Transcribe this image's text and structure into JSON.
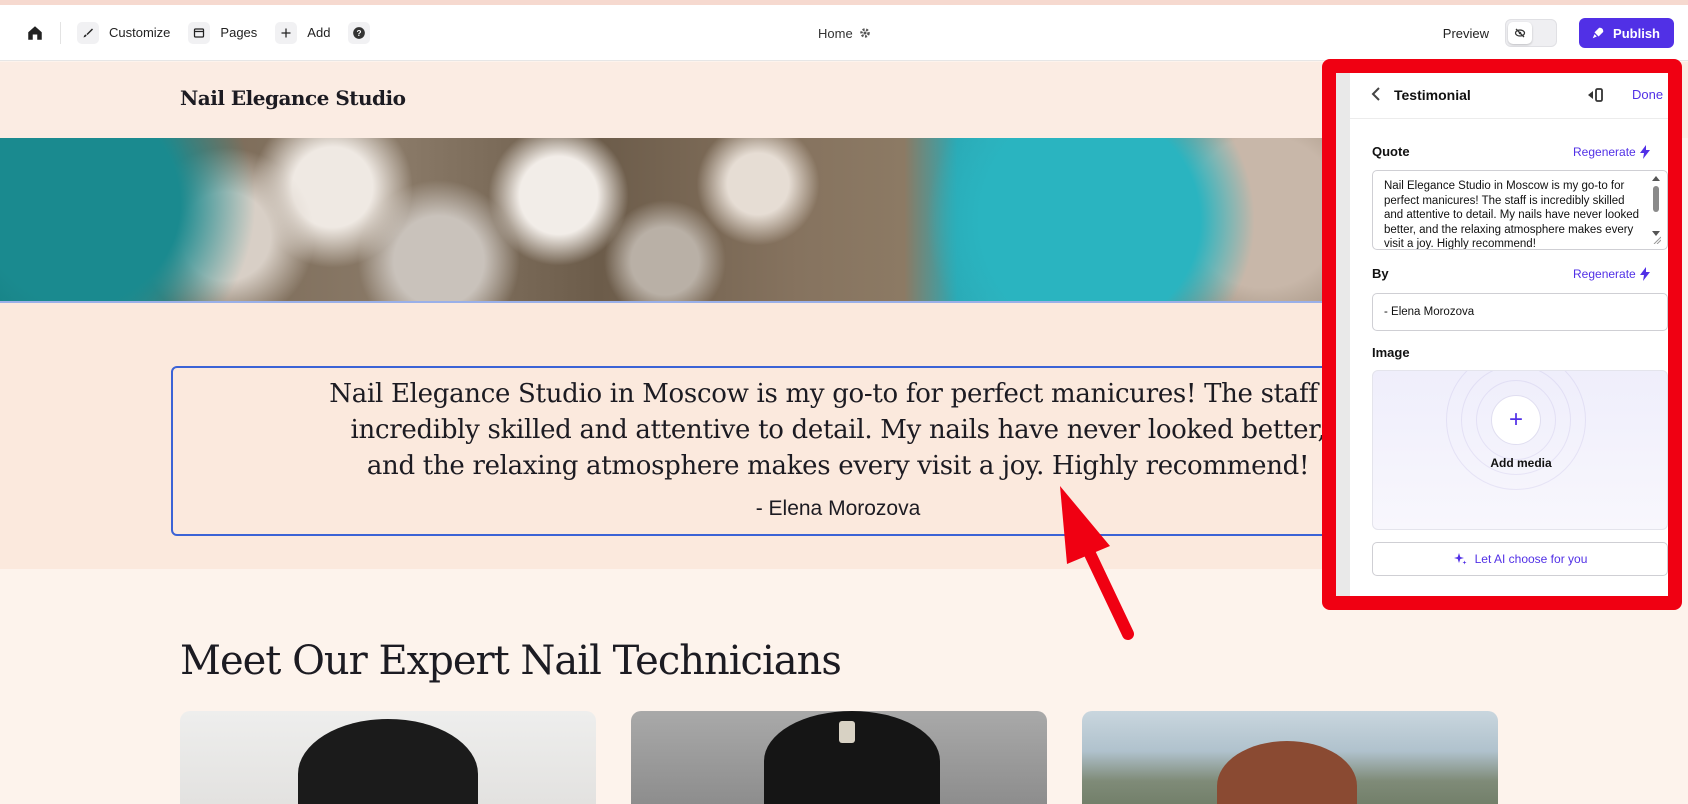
{
  "toolbar": {
    "customize_label": "Customize",
    "pages_label": "Pages",
    "add_label": "Add",
    "current_page": "Home",
    "preview_label": "Preview",
    "publish_label": "Publish",
    "accent_color": "#5130e6"
  },
  "site": {
    "logo": "Nail Elegance Studio",
    "testimonial": {
      "quote": "Nail Elegance Studio in Moscow is my go-to for perfect manicures! The staff is\nincredibly skilled and attentive to detail. My nails have never looked better,\nand the relaxing atmosphere makes every visit a joy. Highly recommend!",
      "author": "- Elena Morozova"
    },
    "technicians_title": "Meet Our Expert Nail Technicians"
  },
  "panel": {
    "title": "Testimonial",
    "done_label": "Done",
    "quote_label": "Quote",
    "regenerate_label": "Regenerate",
    "quote_value": "Nail Elegance Studio in Moscow is my go-to for perfect manicures! The staff is incredibly skilled and attentive to detail. My nails have never looked better, and the relaxing atmosphere makes every visit a joy. Highly recommend!",
    "by_label": "By",
    "by_value": "- Elena Morozova",
    "image_label": "Image",
    "add_media_label": "Add media",
    "ai_choose_label": "Let AI choose for you",
    "highlight_color": "#f00012"
  }
}
